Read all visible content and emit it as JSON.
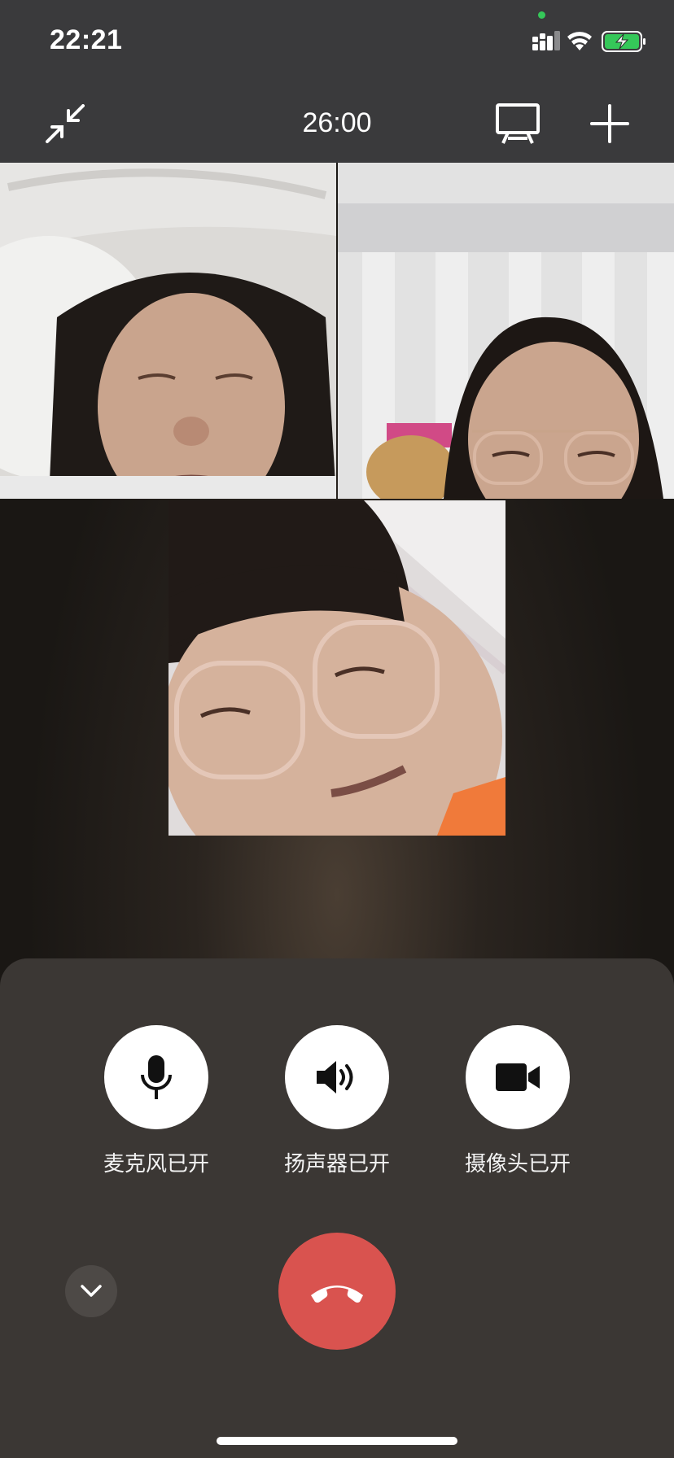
{
  "status_bar": {
    "time": "22:21",
    "icons": [
      "signal-icon",
      "wifi-icon",
      "battery-charging-icon"
    ]
  },
  "call": {
    "timer": "26:00"
  },
  "toolbar": {
    "minimize_icon": "minimize-arrows-icon",
    "screen_share_icon": "screen-share-icon",
    "add_icon": "plus-icon"
  },
  "participants": [
    {
      "id": "participant-1"
    },
    {
      "id": "participant-2"
    },
    {
      "id": "participant-3"
    }
  ],
  "controls": {
    "mic_label": "麦克风已开",
    "speaker_label": "扬声器已开",
    "camera_label": "摄像头已开"
  },
  "colors": {
    "hangup": "#d9534f",
    "panel": "#3b3734",
    "topbar": "#3a3a3c",
    "battery": "#35c759"
  }
}
